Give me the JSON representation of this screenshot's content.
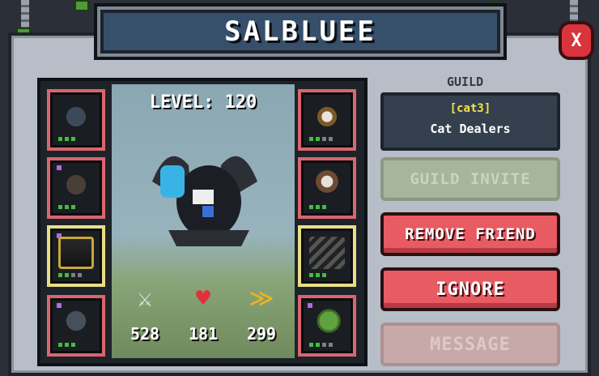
{
  "window": {
    "title": "SALBLUEE",
    "close_label": "X"
  },
  "character": {
    "level_label": "LEVEL: 120"
  },
  "stats": {
    "attack": "528",
    "health": "181",
    "speed": "299"
  },
  "guild": {
    "section_label": "GUILD",
    "tag": "[cat3]",
    "name": "Cat Dealers"
  },
  "buttons": {
    "guild_invite": "GUILD INVITE",
    "remove_friend": "REMOVE FRIEND",
    "ignore": "IGNORE",
    "message": "MESSAGE"
  },
  "equipment": {
    "left": [
      {
        "item": "crossbow-icon",
        "frame": "red"
      },
      {
        "item": "crossbow-icon",
        "frame": "red"
      },
      {
        "item": "golden-bow-icon",
        "frame": "gold"
      },
      {
        "item": "dark-helmet-icon",
        "frame": "red"
      }
    ],
    "right": [
      {
        "item": "skull-medallion-icon",
        "frame": "red"
      },
      {
        "item": "ghost-armor-icon",
        "frame": "red"
      },
      {
        "item": "claw-icon",
        "frame": "gold"
      },
      {
        "item": "turtle-pet-icon",
        "frame": "red"
      }
    ]
  },
  "colors": {
    "accent_red": "#e95b63",
    "guild_tag": "#f1e64a",
    "frame_gold": "#e9de86"
  }
}
